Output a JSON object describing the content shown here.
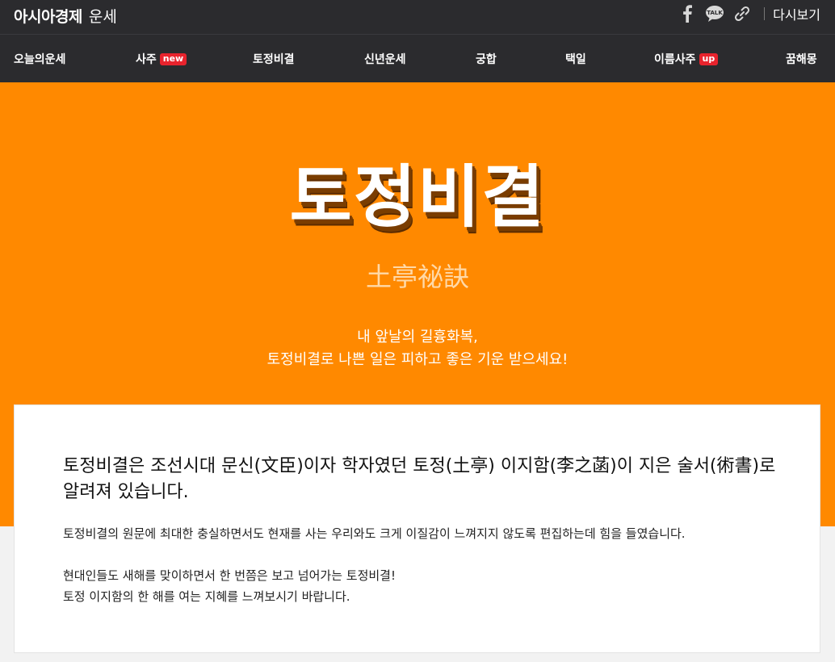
{
  "header": {
    "brand_main": "아시아경제",
    "brand_sub": "운세",
    "icons": [
      "facebook-icon",
      "kakaotalk-icon",
      "link-icon"
    ],
    "kakao_label": "TALK",
    "replay_label": "다시보기"
  },
  "nav": {
    "items": [
      {
        "label": "오늘의운세"
      },
      {
        "label": "사주",
        "badge": "new"
      },
      {
        "label": "토정비결"
      },
      {
        "label": "신년운세"
      },
      {
        "label": "궁합"
      },
      {
        "label": "택일"
      },
      {
        "label": "이름사주",
        "badge": "up"
      },
      {
        "label": "꿈해몽"
      }
    ]
  },
  "hero": {
    "title": "토정비결",
    "hanja": "土亭祕訣",
    "subtitle_line1": "내 앞날의 길흉화복,",
    "subtitle_line2": "토정비결로 나쁜 일은 피하고 좋은 기운 받으세요!"
  },
  "intro": {
    "lead": "토정비결은 조선시대 문신(文臣)이자 학자였던 토정(土亭) 이지함(李之菡)이 지은 술서(術書)로 알려져 있습니다.",
    "p1": "토정비결의 원문에 최대한 충실하면서도 현재를 사는 우리와도 크게 이질감이 느껴지지 않도록 편집하는데 힘을 들였습니다.",
    "p2_line1": "현대인들도 새해를 맞이하면서 한 번쯤은 보고 넘어가는 토정비결!",
    "p2_line2": "토정 이지함의 한 해를 여는 지혜를 느껴보시기 바랍니다."
  },
  "colors": {
    "header_bg": "#2b2b2e",
    "hero_bg": "#ff8900",
    "badge_bg": "#e8232d",
    "page_bg": "#f2f2f2"
  }
}
